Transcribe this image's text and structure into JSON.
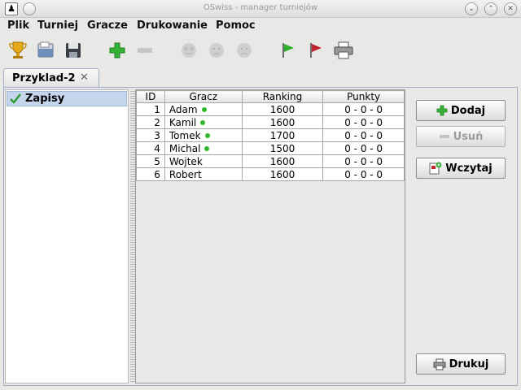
{
  "window": {
    "title": "OSwiss - manager turniejów"
  },
  "menu": [
    "Plik",
    "Turniej",
    "Gracze",
    "Drukowanie",
    "Pomoc"
  ],
  "tab": {
    "label": "Przyklad-2"
  },
  "tree": {
    "item": "Zapisy"
  },
  "table": {
    "headers": [
      "ID",
      "Gracz",
      "Ranking",
      "Punkty"
    ],
    "rows": [
      {
        "id": "1",
        "name": "Adam",
        "online": true,
        "ranking": "1600",
        "points": "0 - 0 - 0"
      },
      {
        "id": "2",
        "name": "Kamil",
        "online": true,
        "ranking": "1600",
        "points": "0 - 0 - 0"
      },
      {
        "id": "3",
        "name": "Tomek",
        "online": true,
        "ranking": "1700",
        "points": "0 - 0 - 0"
      },
      {
        "id": "4",
        "name": "Michal",
        "online": true,
        "ranking": "1500",
        "points": "0 - 0 - 0"
      },
      {
        "id": "5",
        "name": "Wojtek",
        "online": false,
        "ranking": "1600",
        "points": "0 - 0 - 0"
      },
      {
        "id": "6",
        "name": "Robert",
        "online": false,
        "ranking": "1600",
        "points": "0 - 0 - 0"
      }
    ]
  },
  "buttons": {
    "add": "Dodaj",
    "remove": "Usuń",
    "load": "Wczytaj",
    "print": "Drukuj"
  },
  "colors": {
    "accent_green": "#2dbb2d",
    "selection": "#c5d6ec",
    "flag_red": "#c0262c"
  },
  "icons": {
    "toolbar": [
      "trophy-icon",
      "open-file-icon",
      "save-icon",
      "add-icon",
      "remove-icon",
      "smiley-happy-icon",
      "smiley-neutral-icon",
      "smiley-sad-icon",
      "flag-green-icon",
      "flag-red-icon",
      "printer-icon"
    ]
  }
}
